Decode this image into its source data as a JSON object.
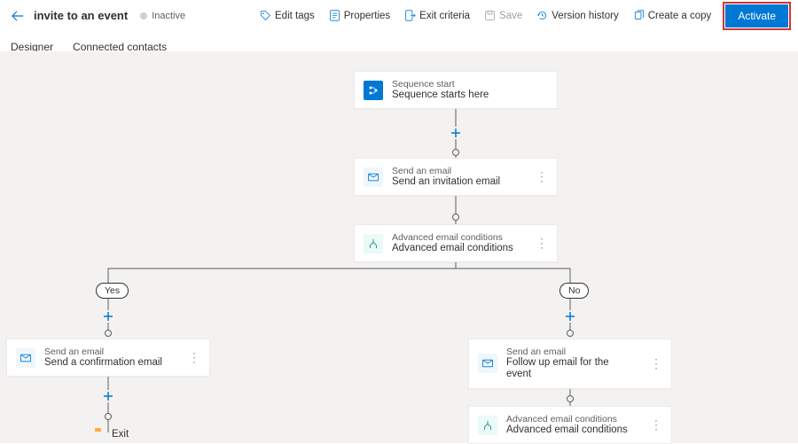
{
  "header": {
    "title": "invite to an event",
    "status": "Inactive"
  },
  "toolbar": {
    "edit_tags": "Edit tags",
    "properties": "Properties",
    "exit_criteria": "Exit criteria",
    "save": "Save",
    "version_history": "Version history",
    "create_copy": "Create a copy",
    "activate": "Activate"
  },
  "tabs": {
    "designer": "Designer",
    "connected": "Connected contacts"
  },
  "branch": {
    "yes": "Yes",
    "no": "No"
  },
  "nodes": {
    "start": {
      "type": "Sequence start",
      "label": "Sequence starts here"
    },
    "invite": {
      "type": "Send an email",
      "label": "Send an invitation email"
    },
    "cond1": {
      "type": "Advanced email conditions",
      "label": "Advanced email conditions"
    },
    "confirm": {
      "type": "Send an email",
      "label": "Send a confirmation email"
    },
    "followup": {
      "type": "Send an email",
      "label": "Follow up email for the event"
    },
    "cond2": {
      "type": "Advanced email conditions",
      "label": "Advanced email conditions"
    },
    "exit": {
      "label": "Exit"
    }
  }
}
